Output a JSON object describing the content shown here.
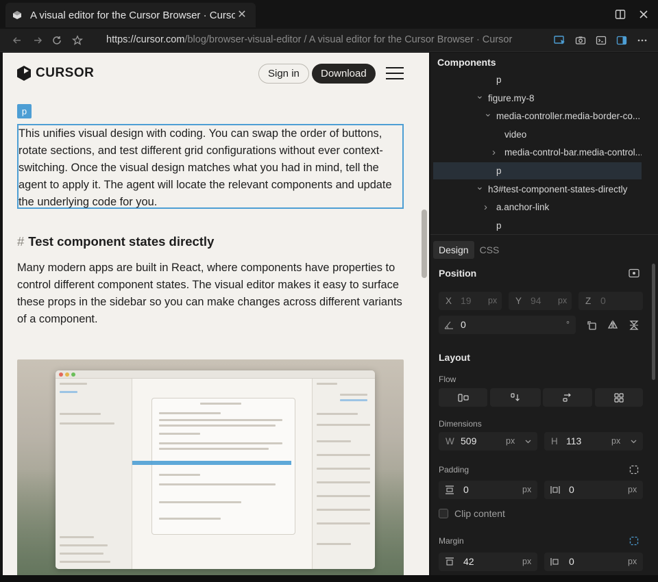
{
  "tab": {
    "title": "A visual editor for the Cursor Browser · Cursor"
  },
  "url": {
    "host": "https://cursor.com",
    "rest": "/blog/browser-visual-editor / A visual editor for the Cursor Browser · Cursor"
  },
  "page": {
    "logo_text": "CURSOR",
    "signin_label": "Sign in",
    "download_label": "Download",
    "selected_tag": "p",
    "paragraph1": "This unifies visual design with coding. You can swap the order of buttons, rotate sections, and test different grid configurations without ever context-switching. Once the visual design matches what you had in mind, tell the agent to apply it. The agent will locate the relevant components and update the underlying code for you.",
    "heading_hash": "#",
    "heading": "Test component states directly",
    "paragraph2": "Many modern apps are built in React, where components have properties to control different component states. The visual editor makes it easy to surface these props in the sidebar so you can make changes across different variants of a component."
  },
  "panel": {
    "components_title": "Components",
    "tree": [
      {
        "label": "p",
        "depth": 3,
        "arrow": ""
      },
      {
        "label": "figure.my-8",
        "depth": 2,
        "arrow": "down"
      },
      {
        "label": "media-controller.media-border-co...",
        "depth": 3,
        "arrow": "down"
      },
      {
        "label": "video",
        "depth": 4,
        "arrow": ""
      },
      {
        "label": "media-control-bar.media-control...",
        "depth": 4,
        "arrow": "right"
      },
      {
        "label": "p",
        "depth": 3,
        "arrow": "",
        "selected": true
      },
      {
        "label": "h3#test-component-states-directly",
        "depth": 2,
        "arrow": "down"
      },
      {
        "label": "a.anchor-link",
        "depth": 3,
        "arrow": "right"
      },
      {
        "label": "p",
        "depth": 3,
        "arrow": ""
      }
    ],
    "tabs": {
      "design": "Design",
      "css": "CSS"
    },
    "position": {
      "title": "Position",
      "x_label": "X",
      "x_value": "19",
      "x_unit": "px",
      "y_label": "Y",
      "y_value": "94",
      "y_unit": "px",
      "z_label": "Z",
      "z_value": "0",
      "rotation_value": "0",
      "rotation_unit": "°"
    },
    "layout": {
      "title": "Layout",
      "flow_label": "Flow",
      "dimensions_label": "Dimensions",
      "w_label": "W",
      "w_value": "509",
      "w_unit": "px",
      "h_label": "H",
      "h_value": "113",
      "h_unit": "px",
      "padding_label": "Padding",
      "padding_v": "0",
      "padding_h": "0",
      "padding_unit": "px",
      "clip_label": "Clip content",
      "margin_label": "Margin",
      "margin_v": "42",
      "margin_h": "0",
      "margin_unit": "px"
    },
    "colors": {
      "selection": "#4d9ed4",
      "panel_bg": "#1c1c1c",
      "page_bg": "#f3f1ed"
    }
  }
}
